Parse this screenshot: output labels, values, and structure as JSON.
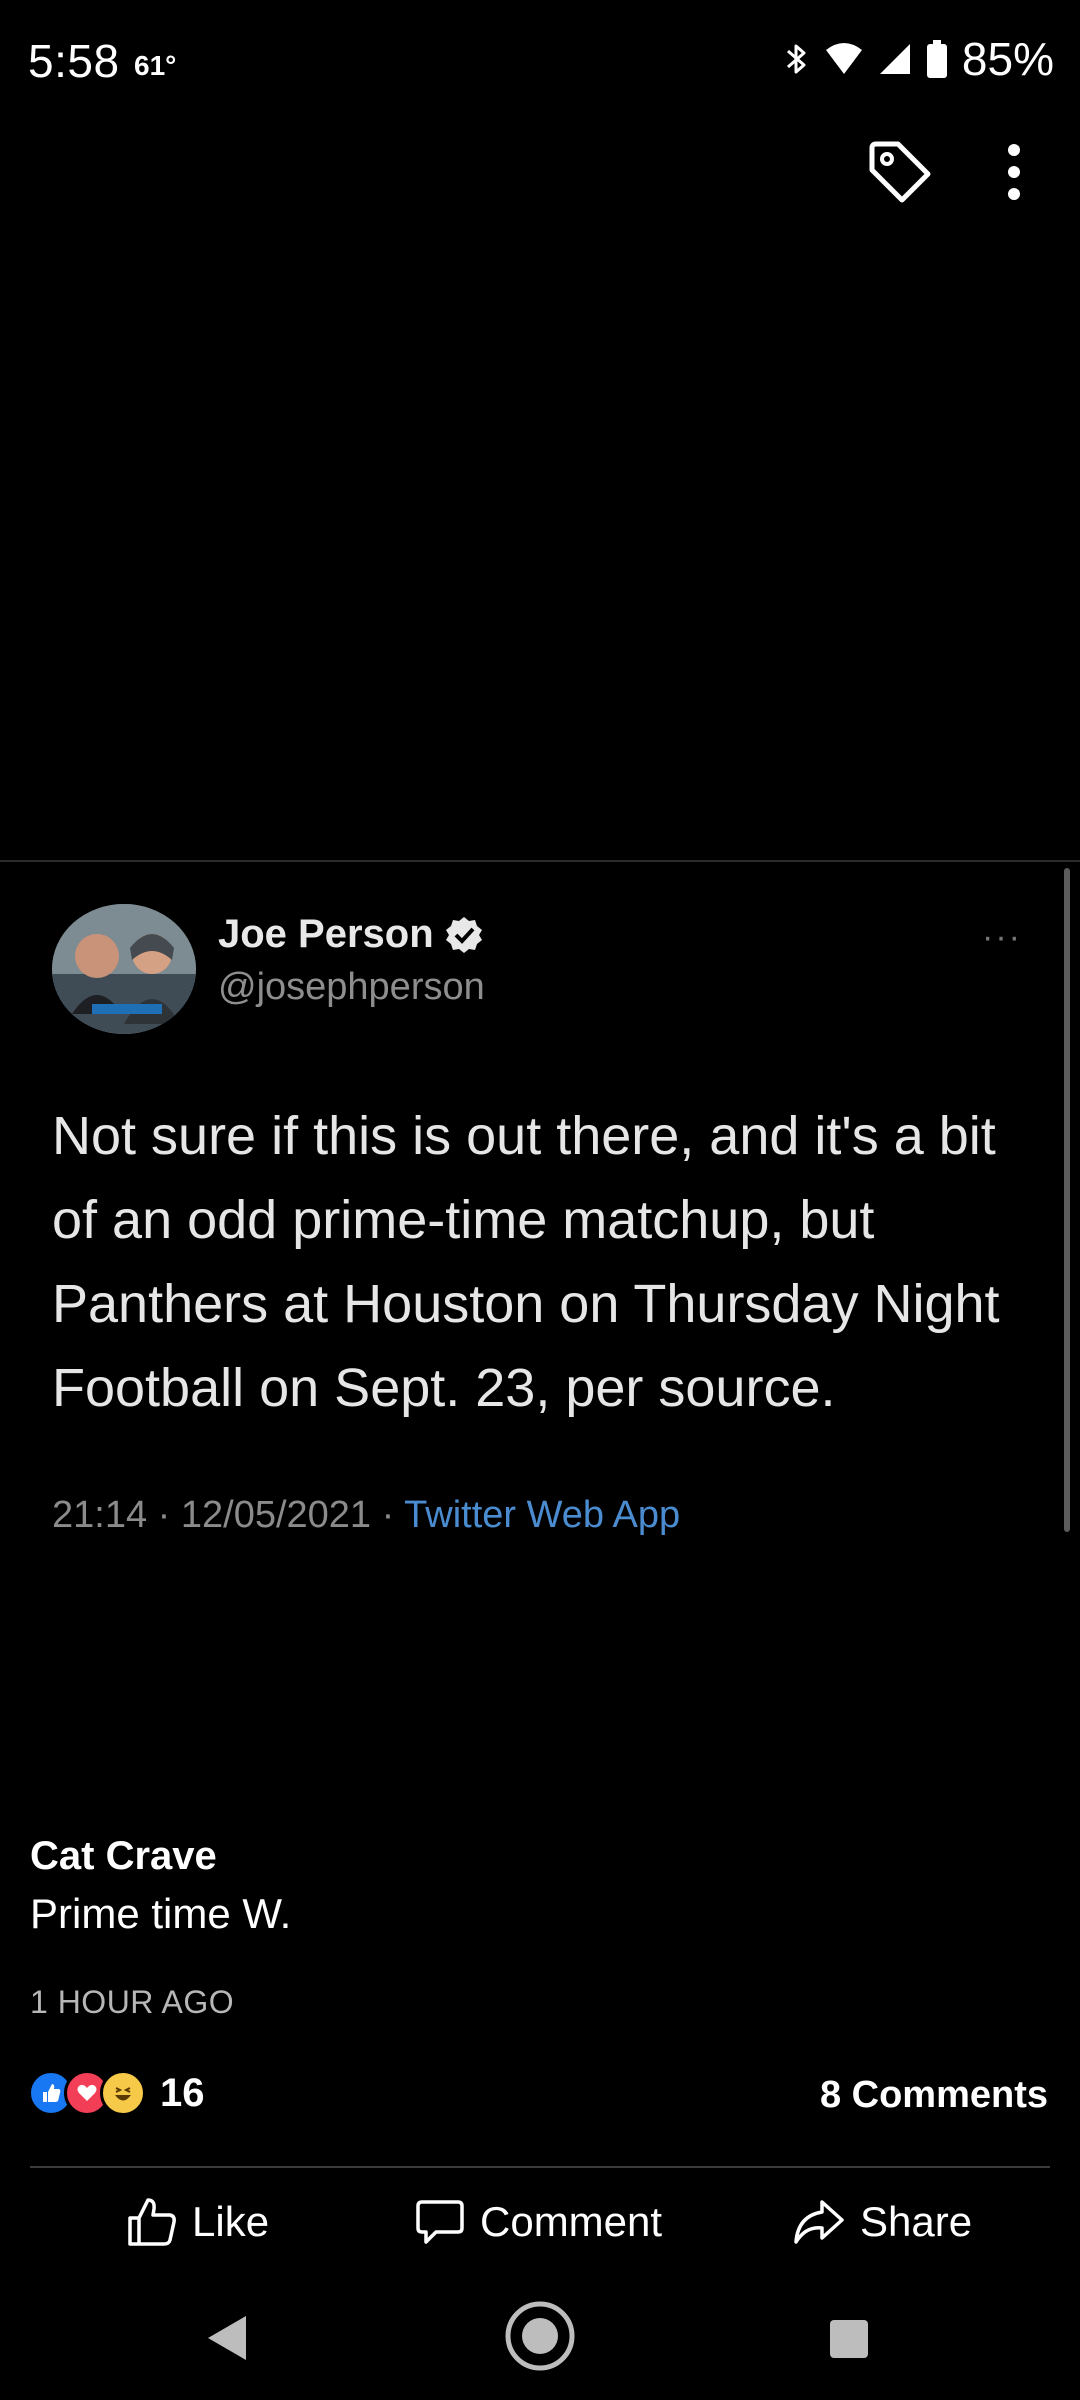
{
  "status_bar": {
    "time": "5:58",
    "temperature": "61°",
    "battery": "85%"
  },
  "tweet": {
    "name": "Joe Person",
    "handle": "@josephperson",
    "text": "Not sure if this is out there, and it's a bit of an odd prime-time matchup, but Panthers at Houston on Thursday Night Football on Sept. 23, per source.",
    "time": "21:14 · 12/05/2021 · ",
    "source": "Twitter Web App",
    "more": "···"
  },
  "post": {
    "author": "Cat Crave",
    "text": "Prime time W.",
    "time": "1 HOUR AGO",
    "reactions_count": "16",
    "comments": "8 Comments"
  },
  "actions": {
    "like": "Like",
    "comment": "Comment",
    "share": "Share"
  },
  "colors": {
    "background": "#000000",
    "link": "#4a8ccf",
    "like_blue": "#1877f2",
    "love_red": "#f33e58",
    "haha_yellow": "#f7c948"
  }
}
